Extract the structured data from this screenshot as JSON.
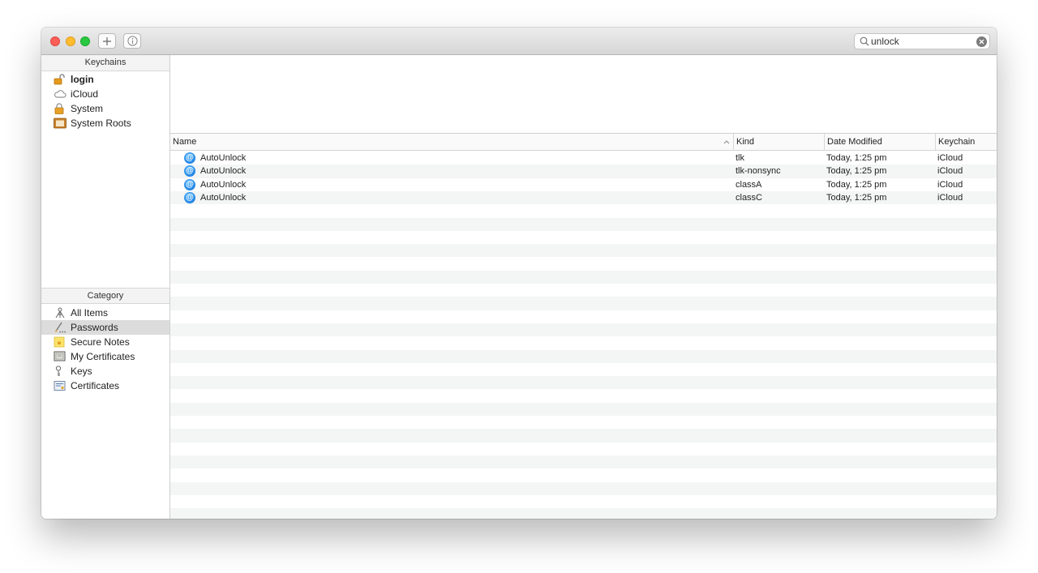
{
  "search": {
    "value": "unlock"
  },
  "sidebar": {
    "keychains_header": "Keychains",
    "keychains": [
      {
        "label": "login",
        "icon": "lock-open-icon"
      },
      {
        "label": "iCloud",
        "icon": "cloud-icon"
      },
      {
        "label": "System",
        "icon": "lock-icon"
      },
      {
        "label": "System Roots",
        "icon": "cabinet-icon"
      }
    ],
    "category_header": "Category",
    "categories": [
      {
        "label": "All Items",
        "icon": "all-items-icon"
      },
      {
        "label": "Passwords",
        "icon": "password-icon",
        "selected": true
      },
      {
        "label": "Secure Notes",
        "icon": "note-icon"
      },
      {
        "label": "My Certificates",
        "icon": "certificate-icon"
      },
      {
        "label": "Keys",
        "icon": "key-icon"
      },
      {
        "label": "Certificates",
        "icon": "certificate-icon"
      }
    ]
  },
  "table": {
    "columns": [
      "Name",
      "Kind",
      "Date Modified",
      "Keychain"
    ],
    "rows": [
      {
        "name": "AutoUnlock",
        "kind": "tlk",
        "date": "Today, 1:25 pm",
        "keychain": "iCloud"
      },
      {
        "name": "AutoUnlock",
        "kind": "tlk-nonsync",
        "date": "Today, 1:25 pm",
        "keychain": "iCloud"
      },
      {
        "name": "AutoUnlock",
        "kind": "classA",
        "date": "Today, 1:25 pm",
        "keychain": "iCloud"
      },
      {
        "name": "AutoUnlock",
        "kind": "classC",
        "date": "Today, 1:25 pm",
        "keychain": "iCloud"
      }
    ]
  }
}
